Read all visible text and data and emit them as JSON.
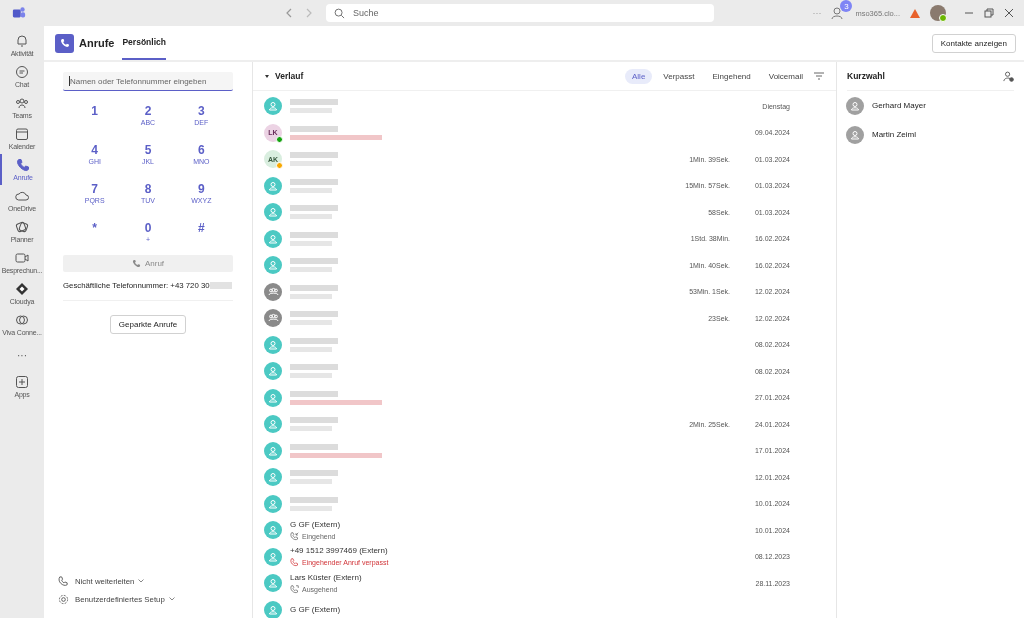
{
  "titlebar": {
    "search_placeholder": "Suche",
    "more": "···",
    "badge": "3",
    "account": "mso365.clo..."
  },
  "rail": [
    {
      "label": "Aktivität",
      "selected": false
    },
    {
      "label": "Chat",
      "selected": false
    },
    {
      "label": "Teams",
      "selected": false
    },
    {
      "label": "Kalender",
      "selected": false
    },
    {
      "label": "Anrufe",
      "selected": true
    },
    {
      "label": "OneDrive",
      "selected": false
    },
    {
      "label": "Planner",
      "selected": false
    },
    {
      "label": "Besprechun...",
      "selected": false
    },
    {
      "label": "Cloudya",
      "selected": false
    },
    {
      "label": "Viva Conne...",
      "selected": false
    }
  ],
  "rail_more": "···",
  "rail_apps": "Apps",
  "header": {
    "title": "Anrufe",
    "tabs": [
      {
        "label": "Persönlich",
        "selected": true
      }
    ],
    "contacts_button": "Kontakte anzeigen"
  },
  "dialer": {
    "placeholder": "Namen oder Telefonnummer eingeben",
    "keys": [
      {
        "digit": "1"
      },
      {
        "digit": "2",
        "letters": "ABC"
      },
      {
        "digit": "3",
        "letters": "DEF"
      },
      {
        "digit": "4",
        "letters": "GHI"
      },
      {
        "digit": "5",
        "letters": "JKL"
      },
      {
        "digit": "6",
        "letters": "MNO"
      },
      {
        "digit": "7",
        "letters": "PQRS"
      },
      {
        "digit": "8",
        "letters": "TUV"
      },
      {
        "digit": "9",
        "letters": "WXYZ"
      },
      {
        "digit": "*"
      },
      {
        "digit": "0",
        "letters": "+"
      },
      {
        "digit": "#"
      }
    ],
    "call_button": {
      "label": "Anruf",
      "disabled": true
    },
    "business_number": "Geschäftliche Telefonnummer: +43 720 30",
    "parked_button": "Geparkte Anrufe",
    "forwarding": "Nicht weiterleiten",
    "setup": "Benutzerdefiniertes Setup"
  },
  "history": {
    "title": "Verlauf",
    "filters": [
      {
        "label": "Alle",
        "selected": true
      },
      {
        "label": "Verpasst",
        "selected": false
      },
      {
        "label": "Eingehend",
        "selected": false
      },
      {
        "label": "Voicemail",
        "selected": false
      }
    ],
    "rows": [
      {
        "kind": "redacted",
        "avatar": {
          "kind": "person"
        },
        "missed": false,
        "date": "Dienstag"
      },
      {
        "kind": "redacted",
        "avatar": {
          "kind": "initials",
          "initials": "LK",
          "color": "#13a10e"
        },
        "missed": true,
        "date": "09.04.2024"
      },
      {
        "kind": "redacted",
        "avatar": {
          "kind": "initials",
          "initials": "AK",
          "color": "#f8a800"
        },
        "missed": false,
        "duration": "1Min. 39Sek.",
        "date": "01.03.2024"
      },
      {
        "kind": "redacted",
        "avatar": {
          "kind": "person"
        },
        "missed": false,
        "duration": "15Min. 57Sek.",
        "date": "01.03.2024"
      },
      {
        "kind": "redacted",
        "avatar": {
          "kind": "person"
        },
        "missed": false,
        "duration": "58Sek.",
        "date": "01.03.2024"
      },
      {
        "kind": "redacted",
        "avatar": {
          "kind": "person"
        },
        "missed": false,
        "duration": "1Std. 38Min.",
        "date": "16.02.2024"
      },
      {
        "kind": "redacted",
        "avatar": {
          "kind": "person"
        },
        "missed": false,
        "duration": "1Min. 40Sek.",
        "date": "16.02.2024"
      },
      {
        "kind": "redacted",
        "avatar": {
          "kind": "group"
        },
        "missed": false,
        "duration": "53Min. 1Sek.",
        "date": "12.02.2024"
      },
      {
        "kind": "redacted",
        "avatar": {
          "kind": "group"
        },
        "missed": false,
        "duration": "23Sek.",
        "date": "12.02.2024"
      },
      {
        "kind": "redacted",
        "avatar": {
          "kind": "person"
        },
        "missed": false,
        "date": "08.02.2024"
      },
      {
        "kind": "redacted",
        "avatar": {
          "kind": "person"
        },
        "missed": false,
        "date": "08.02.2024"
      },
      {
        "kind": "redacted",
        "avatar": {
          "kind": "person"
        },
        "missed": true,
        "date": "27.01.2024"
      },
      {
        "kind": "redacted",
        "avatar": {
          "kind": "person"
        },
        "missed": false,
        "duration": "2Min. 25Sek.",
        "date": "24.01.2024"
      },
      {
        "kind": "redacted",
        "avatar": {
          "kind": "person"
        },
        "missed": true,
        "date": "17.01.2024"
      },
      {
        "kind": "redacted",
        "avatar": {
          "kind": "person"
        },
        "missed": false,
        "date": "12.01.2024"
      },
      {
        "kind": "redacted",
        "avatar": {
          "kind": "person"
        },
        "missed": false,
        "date": "10.01.2024"
      },
      {
        "kind": "named",
        "avatar": {
          "kind": "person"
        },
        "name": "G GF (Extern)",
        "status": {
          "kind": "incoming",
          "text": "Eingehend"
        },
        "date": "10.01.2024"
      },
      {
        "kind": "named",
        "avatar": {
          "kind": "person"
        },
        "name": "+49 1512 3997469 (Extern)",
        "status": {
          "kind": "missed",
          "text": "Eingehender Anruf verpasst"
        },
        "date": "08.12.2023"
      },
      {
        "kind": "named",
        "avatar": {
          "kind": "person"
        },
        "name": "Lars Küster (Extern)",
        "status": {
          "kind": "outgoing",
          "text": "Ausgehend"
        },
        "date": "28.11.2023"
      },
      {
        "kind": "named",
        "avatar": {
          "kind": "person"
        },
        "name": "G GF (Extern)"
      }
    ]
  },
  "speed_dial": {
    "title": "Kurzwahl",
    "contacts": [
      "Gerhard Mayer",
      "Martin Zeiml"
    ]
  }
}
